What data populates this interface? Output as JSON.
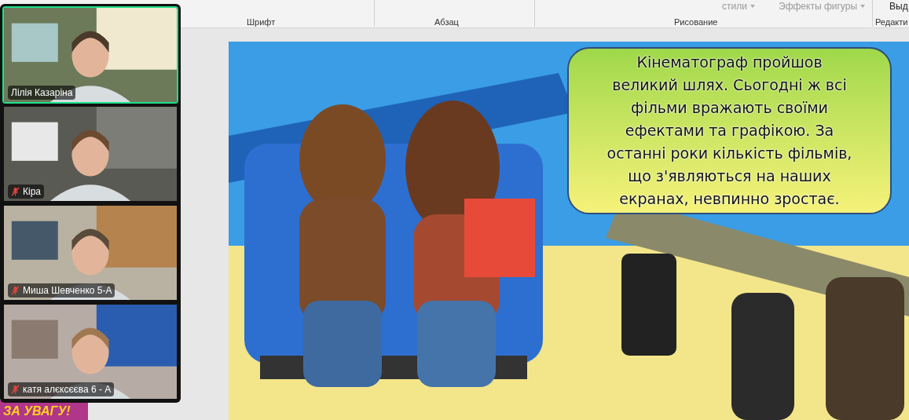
{
  "ribbon": {
    "groups": [
      {
        "label": "Шрифт"
      },
      {
        "label": "Абзац"
      },
      {
        "label": "Рисование"
      },
      {
        "label": "Редакти"
      }
    ],
    "controls": [
      {
        "kind": "dropdown",
        "label": "стили"
      },
      {
        "kind": "dropdown",
        "label": "Эффекты фигуры"
      },
      {
        "kind": "select",
        "label": "Выд"
      }
    ]
  },
  "thumbnail": {
    "text": "ЗА УВАГУ!"
  },
  "participants": [
    {
      "name": "Лілія Казаріна",
      "muted": false,
      "speaking": true
    },
    {
      "name": "Кіра",
      "muted": true,
      "speaking": false
    },
    {
      "name": "Миша Шевченко 5-А",
      "muted": true,
      "speaking": false
    },
    {
      "name": "катя алєксєєва 6 - А",
      "muted": true,
      "speaking": false
    }
  ],
  "slide": {
    "callout_lines": [
      "Кінематограф пройшов",
      "великий шлях. Сьогодні ж всі",
      "фільми вражають своїми",
      "ефектами та графікою. За",
      "останні роки кількість фільмів,",
      "що з'являються на наших",
      "екранах, невпинно зростає."
    ]
  }
}
